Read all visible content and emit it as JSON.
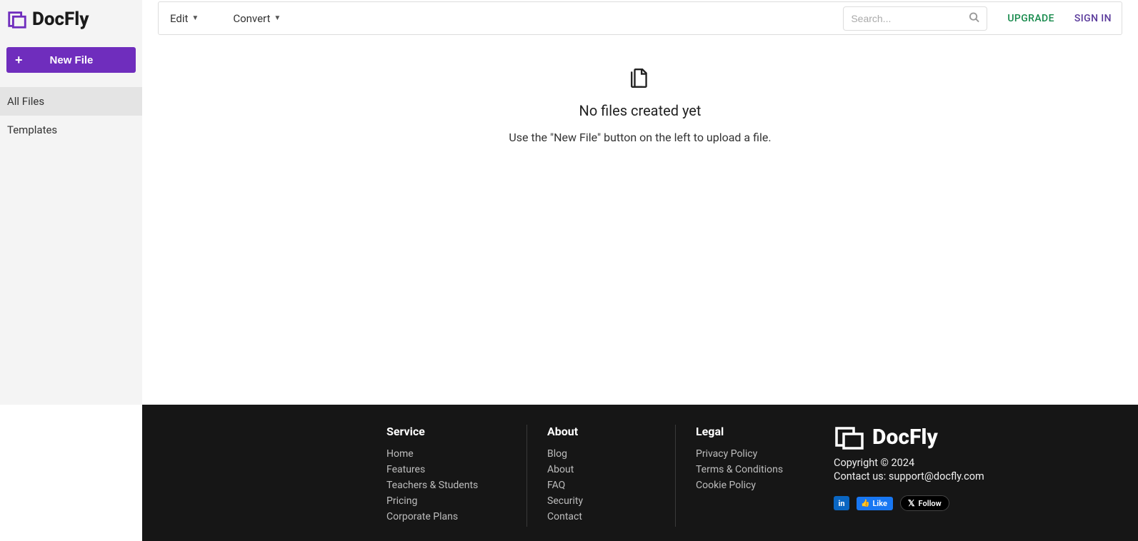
{
  "brand": "DocFly",
  "sidebar": {
    "newFileLabel": "New File",
    "items": [
      {
        "label": "All Files",
        "active": true
      },
      {
        "label": "Templates",
        "active": false
      }
    ]
  },
  "topbar": {
    "menus": [
      {
        "label": "Edit"
      },
      {
        "label": "Convert"
      }
    ],
    "searchPlaceholder": "Search...",
    "upgrade": "UPGRADE",
    "signin": "SIGN IN"
  },
  "empty": {
    "title": "No files created yet",
    "subtitle": "Use the \"New File\" button on the left to upload a file."
  },
  "footer": {
    "columns": [
      {
        "heading": "Service",
        "links": [
          "Home",
          "Features",
          "Teachers & Students",
          "Pricing",
          "Corporate Plans"
        ]
      },
      {
        "heading": "About",
        "links": [
          "Blog",
          "About",
          "FAQ",
          "Security",
          "Contact"
        ]
      },
      {
        "heading": "Legal",
        "links": [
          "Privacy Policy",
          "Terms & Conditions",
          "Cookie Policy"
        ]
      }
    ],
    "copyright": "Copyright © 2024",
    "contactPrefix": "Contact us: ",
    "contactEmail": "support@docfly.com",
    "social": {
      "linkedin": "in",
      "fbLike": "Like",
      "xFollow": "Follow"
    }
  }
}
